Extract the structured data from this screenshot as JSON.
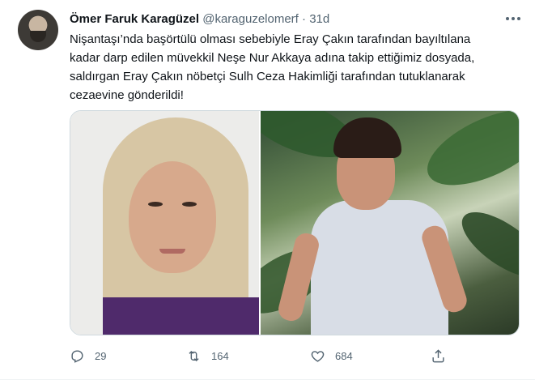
{
  "tweet": {
    "author_name": "Ömer Faruk Karagüzel",
    "handle": "@karaguzelomerf",
    "separator": "·",
    "time": "31d",
    "text_lines": [
      "Nişantaşı’nda başörtülü olması sebebiyle Eray Çakın tarafından bayıltılana",
      "kadar darp edilen müvekkil Neşe Nur Akkaya adına takip ettiğimiz dosyada,",
      "saldırgan Eray Çakın nöbetçi Sulh Ceza Hakimliği tarafından tutuklanarak",
      "cezaevine gönderildi!"
    ],
    "media": [
      {
        "kind": "photo",
        "subject": "woman-in-hijab"
      },
      {
        "kind": "photo",
        "subject": "man-gesturing-under-palm-trees"
      }
    ]
  },
  "actions": {
    "reply_count": "29",
    "retweet_count": "164",
    "like_count": "684",
    "icons": [
      "reply-icon",
      "retweet-icon",
      "like-icon",
      "share-icon",
      "more-icon"
    ]
  },
  "colors": {
    "text_primary": "#0f1419",
    "text_secondary": "#536471",
    "border": "#cfd9de",
    "background": "#ffffff"
  }
}
